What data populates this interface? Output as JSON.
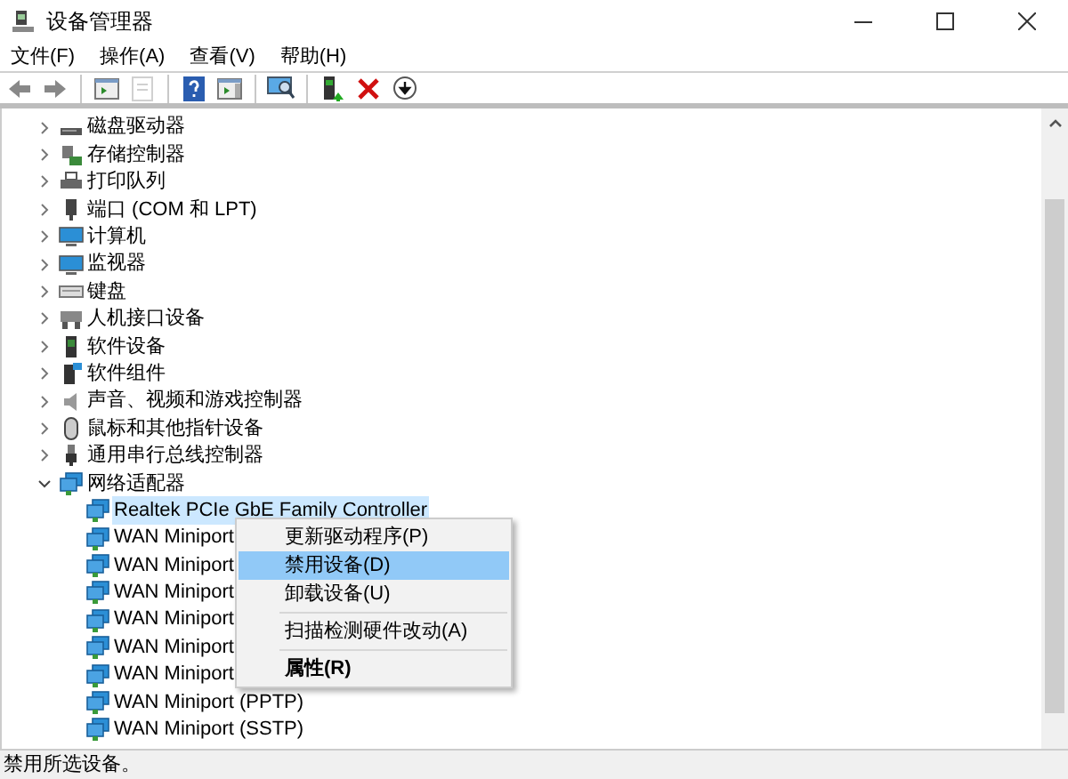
{
  "window": {
    "title": "设备管理器"
  },
  "menu": [
    "文件(F)",
    "操作(A)",
    "查看(V)",
    "帮助(H)"
  ],
  "toolbar": [
    [
      {
        "kind": "back",
        "disabled": false
      },
      {
        "kind": "forward",
        "disabled": false
      }
    ],
    [
      {
        "kind": "console-tree",
        "disabled": false
      },
      {
        "kind": "properties",
        "disabled": true
      }
    ],
    [
      {
        "kind": "help",
        "disabled": false
      },
      {
        "kind": "action-pane",
        "disabled": false
      }
    ],
    [
      {
        "kind": "scan",
        "disabled": false
      }
    ],
    [
      {
        "kind": "update",
        "disabled": false
      },
      {
        "kind": "uninstall",
        "disabled": false
      },
      {
        "kind": "download",
        "disabled": false
      }
    ]
  ],
  "tree": {
    "items": [
      {
        "label": "磁盘驱动器",
        "kind": "drive",
        "expanded": false
      },
      {
        "label": "存储控制器",
        "kind": "storage",
        "expanded": false
      },
      {
        "label": "打印队列",
        "kind": "printer",
        "expanded": false
      },
      {
        "label": "端口 (COM 和 LPT)",
        "kind": "port",
        "expanded": false
      },
      {
        "label": "计算机",
        "kind": "computer",
        "expanded": false
      },
      {
        "label": "监视器",
        "kind": "monitor",
        "expanded": false
      },
      {
        "label": "键盘",
        "kind": "keyboard",
        "expanded": false
      },
      {
        "label": "人机接口设备",
        "kind": "hid",
        "expanded": false
      },
      {
        "label": "软件设备",
        "kind": "software",
        "expanded": false
      },
      {
        "label": "软件组件",
        "kind": "component",
        "expanded": false
      },
      {
        "label": "声音、视频和游戏控制器",
        "kind": "sound",
        "expanded": false
      },
      {
        "label": "鼠标和其他指针设备",
        "kind": "mouse",
        "expanded": false
      },
      {
        "label": "通用串行总线控制器",
        "kind": "usb",
        "expanded": false
      },
      {
        "label": "网络适配器",
        "kind": "network",
        "expanded": true,
        "children": [
          {
            "label": "Realtek PCIe GbE Family Controller",
            "kind": "network",
            "selected": true
          },
          {
            "label": "WAN Miniport",
            "kind": "network",
            "selected": false
          },
          {
            "label": "WAN Miniport",
            "kind": "network",
            "selected": false
          },
          {
            "label": "WAN Miniport",
            "kind": "network",
            "selected": false
          },
          {
            "label": "WAN Miniport",
            "kind": "network",
            "selected": false
          },
          {
            "label": "WAN Miniport",
            "kind": "network",
            "selected": false
          },
          {
            "label": "WAN Miniport",
            "kind": "network",
            "selected": false
          },
          {
            "label": "WAN Miniport (PPTP)",
            "kind": "network",
            "selected": false
          },
          {
            "label": "WAN Miniport (SSTP)",
            "kind": "network",
            "selected": false
          }
        ]
      }
    ]
  },
  "context_menu": [
    [
      {
        "label": "更新驱动程序(P)",
        "selected": false,
        "default": false
      },
      {
        "label": "禁用设备(D)",
        "selected": true,
        "default": false
      },
      {
        "label": "卸载设备(U)",
        "selected": false,
        "default": false
      }
    ],
    [
      {
        "label": "扫描检测硬件改动(A)",
        "selected": false,
        "default": false
      }
    ],
    [
      {
        "label": "属性(R)",
        "selected": false,
        "default": true
      }
    ]
  ],
  "status_bar": "禁用所选设备。"
}
